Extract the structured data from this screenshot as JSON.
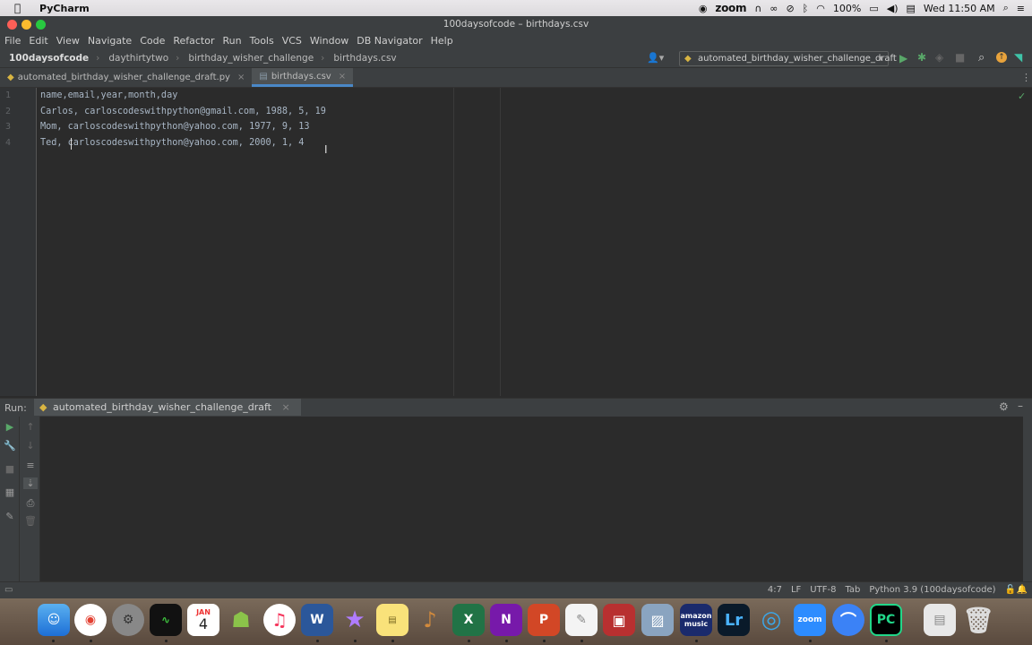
{
  "mac_menubar": {
    "app_name": "PyCharm",
    "zoom_label": "zoom",
    "battery": "100%",
    "clock": "Wed 11:50 AM"
  },
  "window": {
    "title": "100daysofcode – birthdays.csv"
  },
  "ide_menu": [
    "File",
    "Edit",
    "View",
    "Navigate",
    "Code",
    "Refactor",
    "Run",
    "Tools",
    "VCS",
    "Window",
    "DB Navigator",
    "Help"
  ],
  "breadcrumbs": [
    "100daysofcode",
    "daythirtytwo",
    "birthday_wisher_challenge",
    "birthdays.csv"
  ],
  "run_config": "automated_birthday_wisher_challenge_draft",
  "tabs": [
    {
      "label": "automated_birthday_wisher_challenge_draft.py"
    },
    {
      "label": "birthdays.csv"
    }
  ],
  "editor": {
    "line_numbers": [
      "1",
      "2",
      "3",
      "4"
    ],
    "lines": [
      "name,email,year,month,day",
      "Carlos, carloscodeswithpython@gmail.com, 1988, 5, 19",
      "Mom, carloscodeswithpython@yahoo.com, 1977, 9, 13",
      "Ted, carloscodeswithpython@yahoo.com, 2000, 1, 4"
    ]
  },
  "run_panel": {
    "label": "Run:",
    "tab": "automated_birthday_wisher_challenge_draft"
  },
  "status": {
    "position": "4:7",
    "line_sep": "LF",
    "encoding": "UTF-8",
    "indent": "Tab",
    "interpreter": "Python 3.9 (100daysofcode)"
  },
  "dock": {
    "calendar_month": "JAN",
    "calendar_day": "4",
    "amazon_music": "amazon music",
    "zoom": "zoom"
  },
  "colors": {
    "accent": "#4a88c7",
    "run_green": "#59a869",
    "editor_bg": "#2b2b2b",
    "chrome_bg": "#3c3f41"
  }
}
